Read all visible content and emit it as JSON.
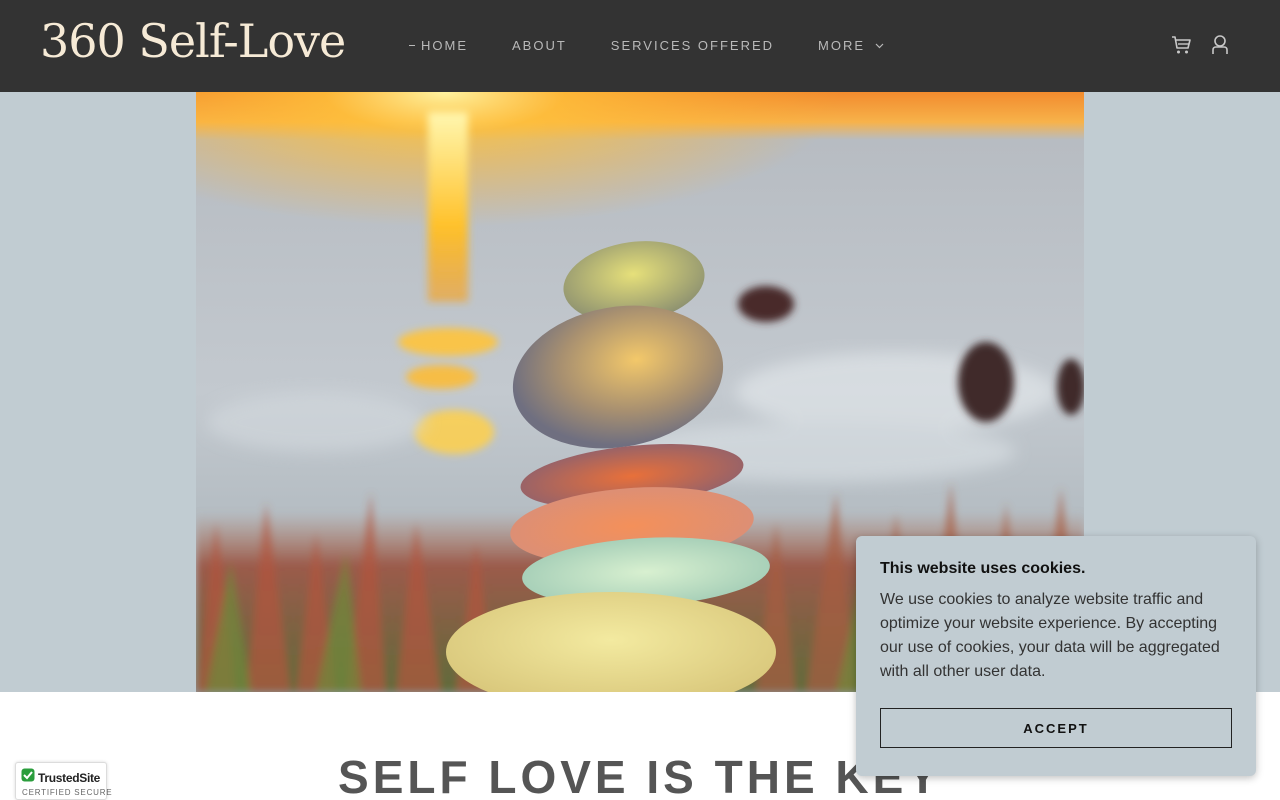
{
  "header": {
    "logo": "360 Self-Love",
    "nav": [
      {
        "label": "HOME",
        "active": true
      },
      {
        "label": "ABOUT"
      },
      {
        "label": "SERVICES OFFERED"
      },
      {
        "label": "MORE",
        "has_dropdown": true
      }
    ],
    "icons": [
      "cart-icon",
      "user-icon"
    ]
  },
  "hero": {
    "image": "stacked-sea-glass-stones-at-sunset"
  },
  "section": {
    "heading": "SELF LOVE IS THE KEY"
  },
  "badge": {
    "name": "TrustedSite",
    "sub": "CERTIFIED SECURE"
  },
  "cookie": {
    "title": "This website uses cookies.",
    "body": "We use cookies to analyze website traffic and optimize your website experience. By accepting our use of cookies, your data will be aggregated with all other user data.",
    "button": "ACCEPT"
  },
  "colors": {
    "header_bg": "#333333",
    "logo": "#f6ead6",
    "nav_text": "#b9b9b9",
    "hero_bg": "#c1ccd2",
    "cookie_bg": "#c1ccd2"
  }
}
